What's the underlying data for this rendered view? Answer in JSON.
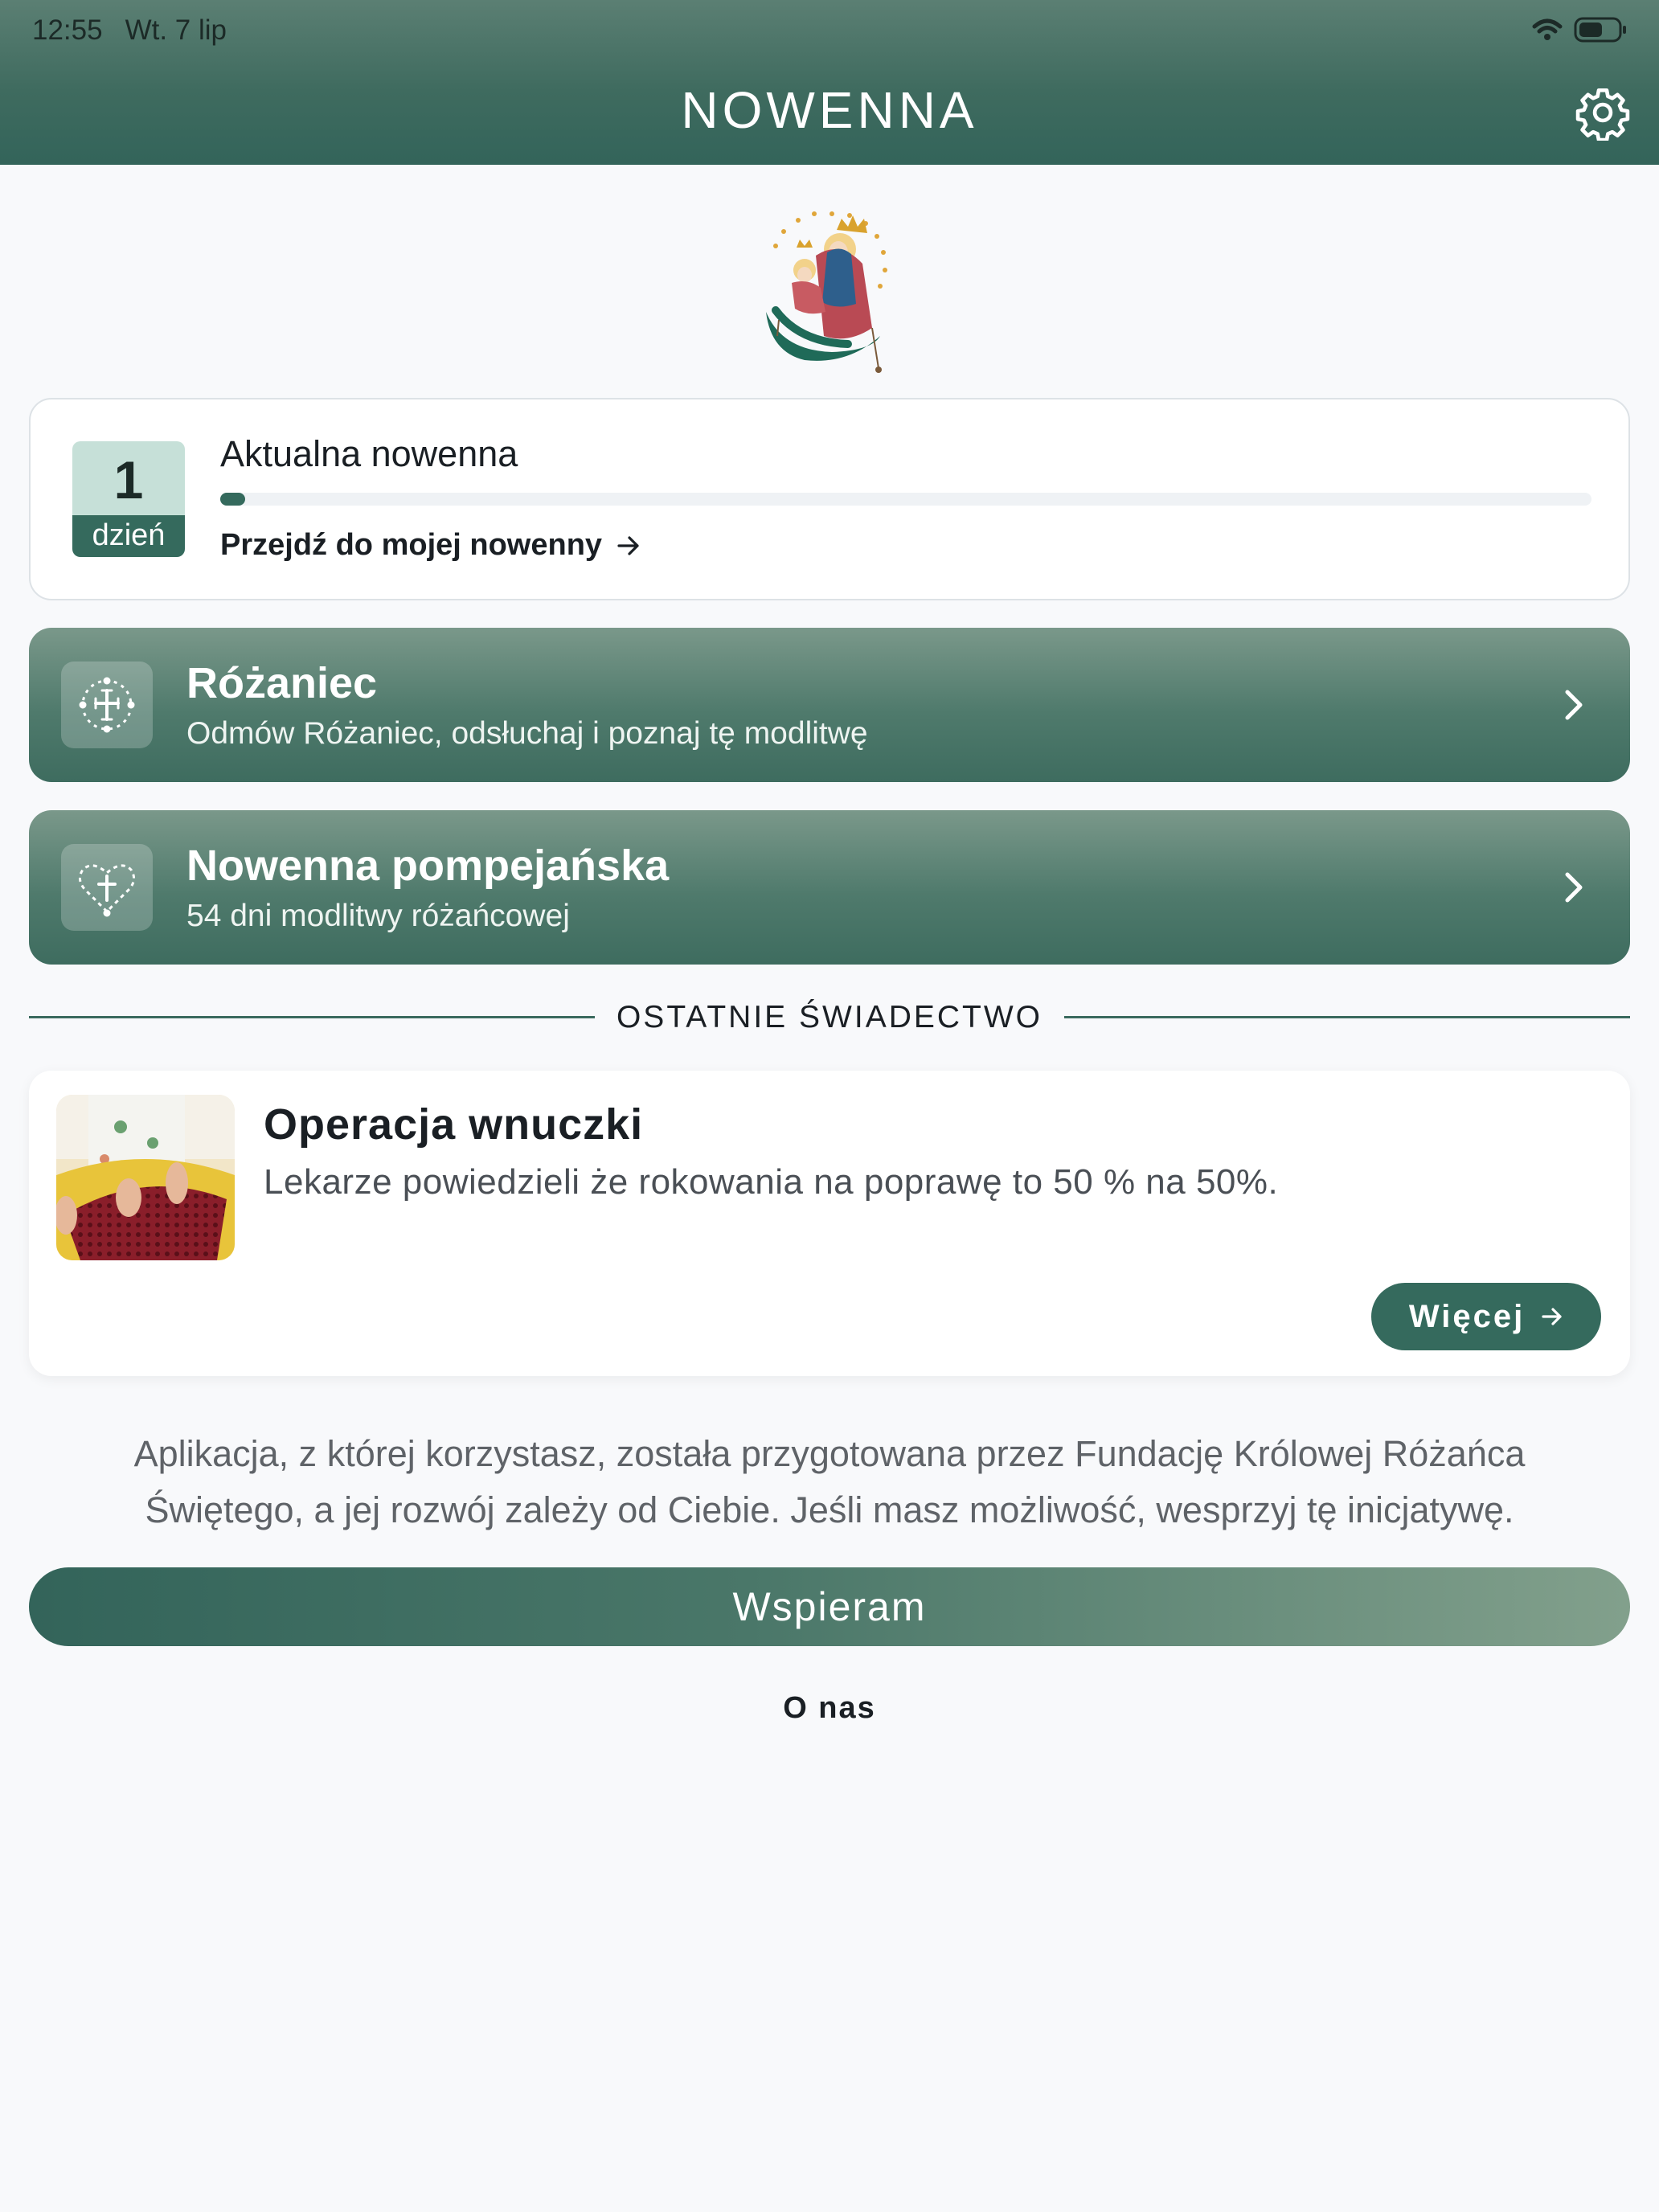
{
  "status_bar": {
    "time": "12:55",
    "date": "Wt. 7 lip"
  },
  "header": {
    "title": "NOWENNA",
    "settings_icon": "gear-icon"
  },
  "current_novena": {
    "day_number": "1",
    "day_label": "dzień",
    "title": "Aktualna nowenna",
    "progress_fraction": 0.018,
    "link_label": "Przejdź do mojej nowenny",
    "link_icon": "arrow-right-icon"
  },
  "prayers": [
    {
      "title": "Różaniec",
      "subtitle": "Odmów Różaniec, odsłuchaj i poznaj tę modlitwę",
      "icon": "rosary-cross-icon"
    },
    {
      "title": "Nowenna pompejańska",
      "subtitle": "54 dni modlitwy różańcowej",
      "icon": "rosary-heart-icon"
    }
  ],
  "testimony_section": {
    "heading": "OSTATNIE ŚWIADECTWO",
    "title": "Operacja wnuczki",
    "text": "Lekarze powiedzieli że rokowania na poprawę to 50 % na 50%.",
    "more_label": "Więcej"
  },
  "support": {
    "text": "Aplikacja, z której korzystasz, została przygotowana przez Fundację Królowej Różańca Świętego, a jej rozwój zależy od Ciebie. Jeśli masz możliwość, wesprzyj tę inicjatywę.",
    "button_label": "Wspieram",
    "about_label": "O nas"
  },
  "colors": {
    "accent": "#356a5d",
    "day_badge_light": "#c6e0d8",
    "header_top": "#5b7f73",
    "header_bottom": "#33645a"
  }
}
